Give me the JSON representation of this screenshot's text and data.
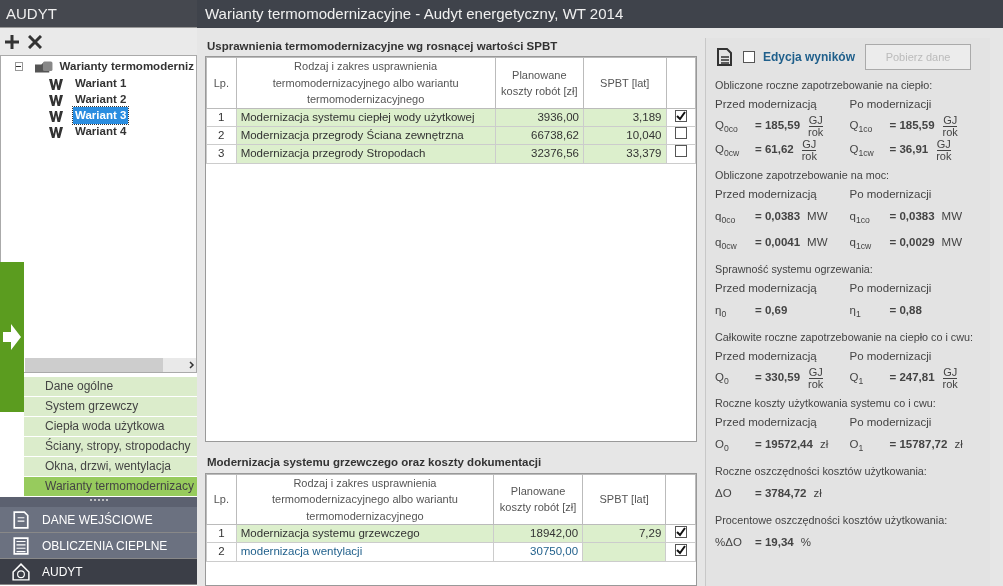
{
  "sidebar": {
    "title": "AUDYT",
    "tree": {
      "label": "Warianty termomoderniz",
      "expanded": true,
      "children": [
        {
          "label": "Wariant 1",
          "selected": false
        },
        {
          "label": "Wariant 2",
          "selected": false
        },
        {
          "label": "Wariant 3",
          "selected": true
        },
        {
          "label": "Wariant 4",
          "selected": false
        }
      ]
    },
    "menu": [
      {
        "label": "Dane ogólne",
        "selected": false
      },
      {
        "label": "System grzewczy",
        "selected": false
      },
      {
        "label": "Ciepła woda użytkowa",
        "selected": false
      },
      {
        "label": "Ściany, stropy, stropodachy",
        "selected": false
      },
      {
        "label": "Okna, drzwi, wentylacja",
        "selected": false
      },
      {
        "label": "Warianty termomodernizacy",
        "selected": true
      }
    ],
    "modules": [
      {
        "label": "DANE WEJŚCIOWE",
        "kind": "input",
        "selected": false
      },
      {
        "label": "OBLICZENIA CIEPLNE",
        "kind": "calc",
        "selected": false
      },
      {
        "label": "AUDYT",
        "kind": "audit",
        "selected": true
      }
    ]
  },
  "window": {
    "title": "Warianty termomodernizacyjne - Audyt energetyczny, WT 2014"
  },
  "tables": [
    {
      "title": "Usprawnienia termomodernizacyjne wg rosnącej wartości SPBT",
      "columns": [
        "Lp.",
        "Rodzaj i zakres usprawnienia termomodernizacyjnego albo wariantu termomodernizacyjnego",
        "Planowane koszty robót [zł]",
        "SPBT [lat]"
      ],
      "rows": [
        {
          "lp": "1",
          "name": "Modernizacja systemu ciepłej wody użytkowej",
          "cost": "3936,00",
          "spbt": "3,189",
          "checked": true,
          "kind": "auto"
        },
        {
          "lp": "2",
          "name": "Modernizacja przegrody Ściana zewnętrzna",
          "cost": "66738,62",
          "spbt": "10,040",
          "checked": false,
          "kind": "auto"
        },
        {
          "lp": "3",
          "name": "Modernizacja przegrody Stropodach",
          "cost": "32376,56",
          "spbt": "33,379",
          "checked": false,
          "kind": "auto"
        }
      ]
    },
    {
      "title": "Modernizacja systemu grzewczego oraz koszty dokumentacji",
      "columns": [
        "Lp.",
        "Rodzaj i zakres usprawnienia termomodernizacyjnego albo wariantu termomodernizacyjnego",
        "Planowane koszty robót [zł]",
        "SPBT [lat]"
      ],
      "rows": [
        {
          "lp": "1",
          "name": "Modernizacja systemu grzewczego",
          "cost": "18942,00",
          "spbt": "7,29",
          "checked": true,
          "kind": "auto"
        },
        {
          "lp": "2",
          "name": "modernizacja wentylacji",
          "cost": "30750,00",
          "checked": true,
          "kind": "manual"
        }
      ]
    }
  ],
  "results": {
    "edit": {
      "label": "Edycja wyników",
      "checked": false
    },
    "fetch_button": {
      "label": "Pobierz dane",
      "disabled": true
    },
    "sections": [
      {
        "title": "Obliczone roczne zapotrzebowanie na ciepło:",
        "headers": [
          "Przed modernizacją",
          "Po modernizacji"
        ],
        "lines": [
          [
            {
              "symbol": "Q$_{0co}$",
              "value": "= 185,59",
              "fraction": {
                "numerator": "GJ",
                "denominator": "rok"
              }
            },
            {
              "symbol": "Q$_{1co}$",
              "value": "= 185,59",
              "fraction": {
                "numerator": "GJ",
                "denominator": "rok"
              }
            }
          ],
          [
            {
              "symbol": "Q$_{0cw}$",
              "value": "= 61,62",
              "fraction": {
                "numerator": "GJ",
                "denominator": "rok"
              }
            },
            {
              "symbol": "Q$_{1cw}$",
              "value": "= 36,91",
              "fraction": {
                "numerator": "GJ",
                "denominator": "rok"
              }
            }
          ]
        ]
      },
      {
        "title": "Obliczone zapotrzebowanie na moc:",
        "headers": [
          "Przed modernizacją",
          "Po modernizacji"
        ],
        "lines": [
          [
            {
              "symbol": "q$_{0co}$",
              "value": "= 0,0383",
              "unit": "MW"
            },
            {
              "symbol": "q$_{1co}$",
              "value": "= 0,0383",
              "unit": "MW"
            }
          ],
          [
            {
              "symbol": "q$_{0cw}$",
              "value": "= 0,0041",
              "unit": "MW"
            },
            {
              "symbol": "q$_{1cw}$",
              "value": "= 0,0029",
              "unit": "MW"
            }
          ]
        ]
      },
      {
        "title": "Sprawność systemu ogrzewania:",
        "headers": [
          "Przed modernizacją",
          "Po modernizacji"
        ],
        "lines": [
          [
            {
              "symbol": "η$_{0}$",
              "value": "= 0,69"
            },
            {
              "symbol": "η$_{1}$",
              "value": "= 0,88"
            }
          ]
        ]
      },
      {
        "title": "Całkowite roczne zapotrzebowanie na ciepło co i cwu:",
        "headers": [
          "Przed modernizacją",
          "Po modernizacji"
        ],
        "lines": [
          [
            {
              "symbol": "Q$_{0}$",
              "value": "= 330,59",
              "fraction": {
                "numerator": "GJ",
                "denominator": "rok"
              }
            },
            {
              "symbol": "Q$_{1}$",
              "value": "= 247,81",
              "fraction": {
                "numerator": "GJ",
                "denominator": "rok"
              }
            }
          ]
        ]
      },
      {
        "title": "Roczne koszty użytkowania systemu co i cwu:",
        "headers": [
          "Przed modernizacją",
          "Po modernizacji"
        ],
        "lines": [
          [
            {
              "symbol": "O$_{0}$",
              "value": "= 19572,44",
              "unit": "zł"
            },
            {
              "symbol": "O$_{1}$",
              "value": "= 15787,72",
              "unit": "zł"
            }
          ]
        ]
      },
      {
        "title": "Roczne oszczędności kosztów użytkowania:",
        "lines": [
          [
            {
              "symbol": "ΔO",
              "value": "= 3784,72",
              "unit": "zł"
            }
          ]
        ]
      },
      {
        "title": "Procentowe oszczędności kosztów użytkowania:",
        "lines": [
          [
            {
              "symbol": "%ΔO",
              "value": "= 19,34",
              "unit": "%"
            }
          ]
        ]
      }
    ]
  }
}
